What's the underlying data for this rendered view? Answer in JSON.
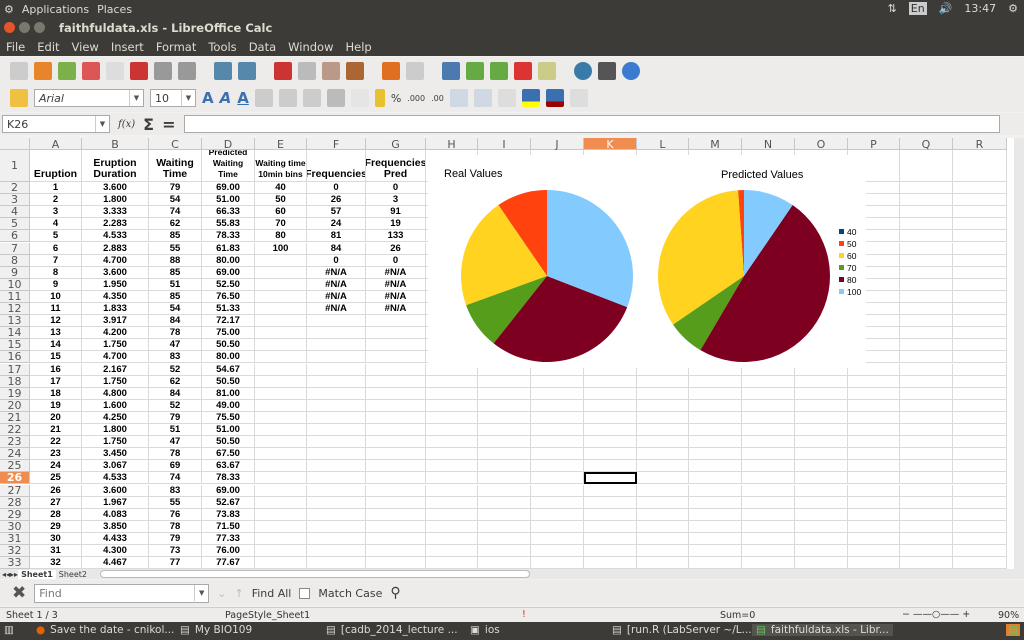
{
  "system": {
    "menu": [
      "Applications",
      "Places"
    ],
    "time": "13:47",
    "keyboard": "En"
  },
  "window": {
    "title": "faithfuldata.xls - LibreOffice Calc"
  },
  "menu": [
    "File",
    "Edit",
    "View",
    "Insert",
    "Format",
    "Tools",
    "Data",
    "Window",
    "Help"
  ],
  "format_bar": {
    "font": "Arial",
    "size": "10"
  },
  "formula_bar": {
    "cell_ref": "K26",
    "fx": "f(x)",
    "sum": "Σ",
    "equals": "=",
    "value": ""
  },
  "columns": [
    "A",
    "B",
    "C",
    "D",
    "E",
    "F",
    "G",
    "H",
    "I",
    "J",
    "K",
    "L",
    "M",
    "N",
    "O",
    "P",
    "Q",
    "R"
  ],
  "active_cell": {
    "column": "K",
    "row": 26
  },
  "headers": [
    "Eruption",
    "Eruption Duration",
    "Waiting Time",
    "Predicted Waiting Time",
    "Waiting time 10min bins",
    "Frequencies",
    "Frequencies Pred"
  ],
  "rows": [
    [
      "1",
      "3.600",
      "79",
      "69.00",
      "40",
      "0",
      "0"
    ],
    [
      "2",
      "1.800",
      "54",
      "51.00",
      "50",
      "26",
      "3"
    ],
    [
      "3",
      "3.333",
      "74",
      "66.33",
      "60",
      "57",
      "91"
    ],
    [
      "4",
      "2.283",
      "62",
      "55.83",
      "70",
      "24",
      "19"
    ],
    [
      "5",
      "4.533",
      "85",
      "78.33",
      "80",
      "81",
      "133"
    ],
    [
      "6",
      "2.883",
      "55",
      "61.83",
      "100",
      "84",
      "26"
    ],
    [
      "7",
      "4.700",
      "88",
      "80.00",
      "",
      "0",
      "0"
    ],
    [
      "8",
      "3.600",
      "85",
      "69.00",
      "",
      "#N/A",
      "#N/A"
    ],
    [
      "9",
      "1.950",
      "51",
      "52.50",
      "",
      "#N/A",
      "#N/A"
    ],
    [
      "10",
      "4.350",
      "85",
      "76.50",
      "",
      "#N/A",
      "#N/A"
    ],
    [
      "11",
      "1.833",
      "54",
      "51.33",
      "",
      "#N/A",
      "#N/A"
    ],
    [
      "12",
      "3.917",
      "84",
      "72.17",
      "",
      "",
      ""
    ],
    [
      "13",
      "4.200",
      "78",
      "75.00",
      "",
      "",
      ""
    ],
    [
      "14",
      "1.750",
      "47",
      "50.50",
      "",
      "",
      ""
    ],
    [
      "15",
      "4.700",
      "83",
      "80.00",
      "",
      "",
      ""
    ],
    [
      "16",
      "2.167",
      "52",
      "54.67",
      "",
      "",
      ""
    ],
    [
      "17",
      "1.750",
      "62",
      "50.50",
      "",
      "",
      ""
    ],
    [
      "18",
      "4.800",
      "84",
      "81.00",
      "",
      "",
      ""
    ],
    [
      "19",
      "1.600",
      "52",
      "49.00",
      "",
      "",
      ""
    ],
    [
      "20",
      "4.250",
      "79",
      "75.50",
      "",
      "",
      ""
    ],
    [
      "21",
      "1.800",
      "51",
      "51.00",
      "",
      "",
      ""
    ],
    [
      "22",
      "1.750",
      "47",
      "50.50",
      "",
      "",
      ""
    ],
    [
      "23",
      "3.450",
      "78",
      "67.50",
      "",
      "",
      ""
    ],
    [
      "24",
      "3.067",
      "69",
      "63.67",
      "",
      "",
      ""
    ],
    [
      "25",
      "4.533",
      "74",
      "78.33",
      "",
      "",
      ""
    ],
    [
      "26",
      "3.600",
      "83",
      "69.00",
      "",
      "",
      ""
    ],
    [
      "27",
      "1.967",
      "55",
      "52.67",
      "",
      "",
      ""
    ],
    [
      "28",
      "4.083",
      "76",
      "73.83",
      "",
      "",
      ""
    ],
    [
      "29",
      "3.850",
      "78",
      "71.50",
      "",
      "",
      ""
    ],
    [
      "30",
      "4.433",
      "79",
      "77.33",
      "",
      "",
      ""
    ],
    [
      "31",
      "4.300",
      "73",
      "76.00",
      "",
      "",
      ""
    ],
    [
      "32",
      "4.467",
      "77",
      "77.67",
      "",
      "",
      ""
    ]
  ],
  "chart_data": [
    {
      "type": "pie",
      "title": "Real Values",
      "categories": [
        "40",
        "50",
        "60",
        "70",
        "80",
        "100"
      ],
      "values": [
        0,
        26,
        57,
        24,
        81,
        84
      ]
    },
    {
      "type": "pie",
      "title": "Predicted Values",
      "categories": [
        "40",
        "50",
        "60",
        "70",
        "80",
        "100"
      ],
      "values": [
        0,
        3,
        91,
        19,
        133,
        26
      ],
      "legend": "right"
    }
  ],
  "chart_colors": [
    "#004586",
    "#ff420e",
    "#ffd320",
    "#579d1c",
    "#7e0021",
    "#83caff"
  ],
  "sheet_tabs": [
    "Sheet1",
    "Sheet2"
  ],
  "find_bar": {
    "placeholder": "Find",
    "find_all": "Find All",
    "match_case": "Match Case"
  },
  "status": {
    "sheet": "Sheet 1 / 3",
    "page_style": "PageStyle_Sheet1",
    "sum": "Sum=0",
    "zoom": "90%"
  },
  "taskbar": [
    "Save the date - cnikol...",
    "My BIO109",
    "[cadb_2014_lecture ...",
    "ios",
    "[run.R (LabServer ~/L...",
    "faithfuldata.xls - Libr..."
  ]
}
